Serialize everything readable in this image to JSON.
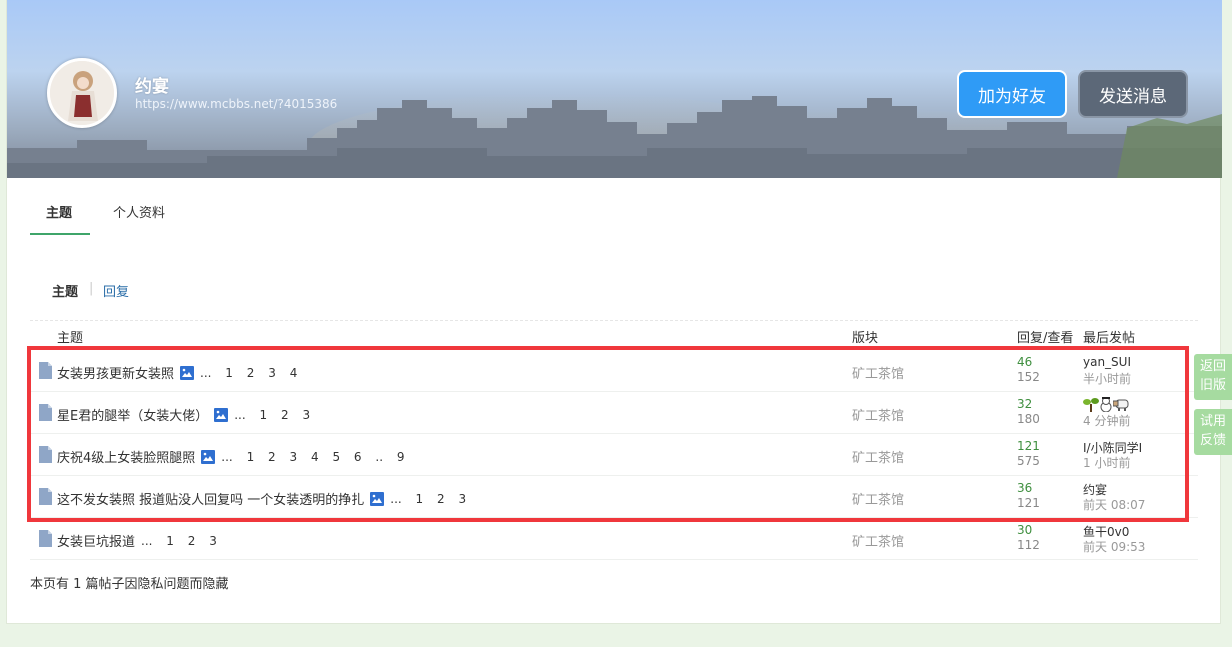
{
  "profile": {
    "name": "约宴",
    "url": "https://www.mcbbs.net/?4015386",
    "add_friend_label": "加为好友",
    "send_message_label": "发送消息"
  },
  "tabs": [
    {
      "label": "主题",
      "active": true
    },
    {
      "label": "个人资料",
      "active": false
    }
  ],
  "subtabs": [
    {
      "label": "主题",
      "active": true
    },
    {
      "label": "回复",
      "active": false
    }
  ],
  "subtab_separator": "|",
  "table": {
    "headers": {
      "topic": "主题",
      "forum": "版块",
      "stats": "回复/查看",
      "last": "最后发帖"
    },
    "rows": [
      {
        "title": "女装男孩更新女装照",
        "has_image": true,
        "ellipsis": "...",
        "pages": [
          "1",
          "2",
          "3",
          "4"
        ],
        "forum": "矿工茶馆",
        "replies": "46",
        "views": "152",
        "last_user": "yan_SUI",
        "last_time": "半小时前"
      },
      {
        "title": "星E君的腿举（女装大佬）",
        "has_image": true,
        "ellipsis": "...",
        "pages": [
          "1",
          "2",
          "3"
        ],
        "forum": "矿工茶馆",
        "replies": "32",
        "views": "180",
        "last_user": "",
        "last_user_icons": [
          "sapling-icon",
          "snowman-icon",
          "sheep-icon"
        ],
        "last_time": "4 分钟前"
      },
      {
        "title": "庆祝4级上女装脸照腿照",
        "has_image": true,
        "ellipsis": "...",
        "pages": [
          "1",
          "2",
          "3",
          "4",
          "5",
          "6",
          "..",
          "9"
        ],
        "forum": "矿工茶馆",
        "replies": "121",
        "views": "575",
        "last_user": "I/小陈同学I",
        "last_time": "1 小时前"
      },
      {
        "title": "这不发女装照 报道贴没人回复吗 一个女装透明的挣扎",
        "has_image": true,
        "ellipsis": "...",
        "pages": [
          "1",
          "2",
          "3"
        ],
        "forum": "矿工茶馆",
        "replies": "36",
        "views": "121",
        "last_user": "约宴",
        "last_time": "前天 08:07"
      },
      {
        "title": "女装巨坑报道",
        "has_image": false,
        "ellipsis": "...",
        "pages": [
          "1",
          "2",
          "3"
        ],
        "forum": "矿工茶馆",
        "replies": "30",
        "views": "112",
        "last_user": "鱼干0v0",
        "last_time": "前天 09:53"
      }
    ]
  },
  "hidden_note": "本页有 1 篇帖子因隐私问题而隐藏",
  "side": {
    "back_old_line1": "返回",
    "back_old_line2": "旧版",
    "feedback_line1": "试用",
    "feedback_line2": "反馈"
  },
  "colors": {
    "highlight_border": "#f0373c",
    "accent_green": "#3fa56a",
    "friend_button": "#2f9bf6",
    "message_button": "#5c6878",
    "side_button": "#a6dba0"
  }
}
